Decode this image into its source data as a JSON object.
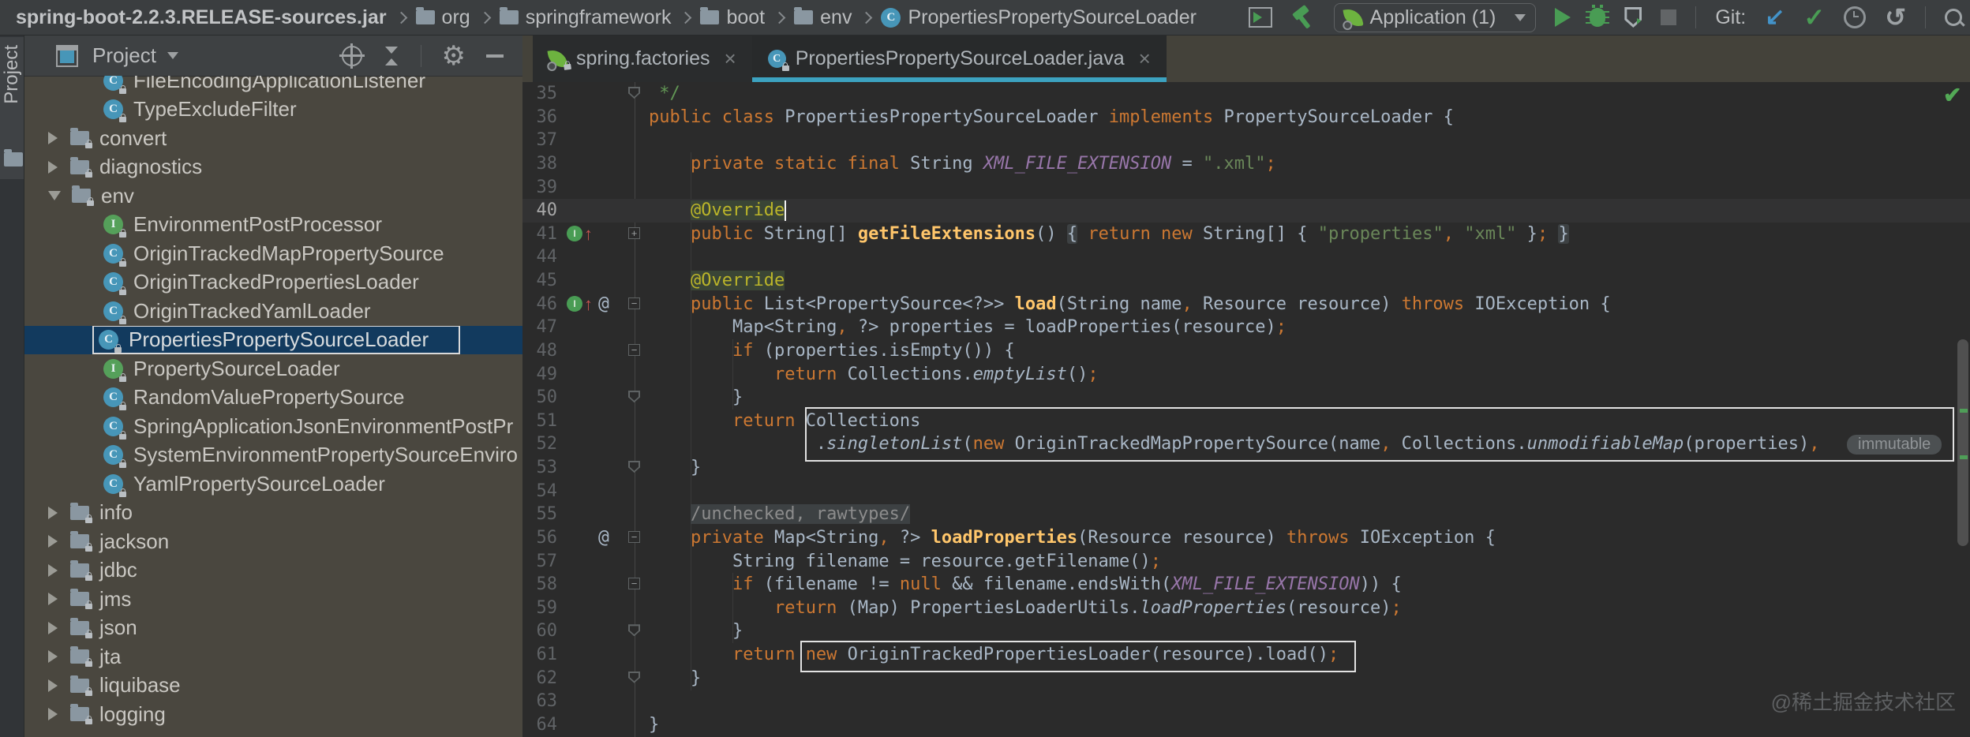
{
  "breadcrumbs": [
    {
      "label": "spring-boot-2.2.3.RELEASE-sources.jar",
      "icon": "none"
    },
    {
      "label": "org",
      "icon": "folder"
    },
    {
      "label": "springframework",
      "icon": "folder"
    },
    {
      "label": "boot",
      "icon": "folder"
    },
    {
      "label": "env",
      "icon": "folder"
    },
    {
      "label": "PropertiesPropertySourceLoader",
      "icon": "class"
    }
  ],
  "toolbar": {
    "run_config_label": "Application (1)",
    "git_label": "Git:"
  },
  "stripe": {
    "project_button": "Project"
  },
  "project_panel": {
    "title": "Project",
    "tree": [
      {
        "label": "FileEncodingApplicationListener",
        "icon": "class",
        "depth": 2
      },
      {
        "label": "TypeExcludeFilter",
        "icon": "class",
        "depth": 2
      },
      {
        "label": "convert",
        "icon": "folder",
        "depth": 1,
        "arrow": "right"
      },
      {
        "label": "diagnostics",
        "icon": "folder",
        "depth": 1,
        "arrow": "right"
      },
      {
        "label": "env",
        "icon": "folder",
        "depth": 1,
        "arrow": "down"
      },
      {
        "label": "EnvironmentPostProcessor",
        "icon": "interface",
        "depth": 2
      },
      {
        "label": "OriginTrackedMapPropertySource",
        "icon": "class",
        "depth": 2
      },
      {
        "label": "OriginTrackedPropertiesLoader",
        "icon": "class",
        "depth": 2
      },
      {
        "label": "OriginTrackedYamlLoader",
        "icon": "class",
        "depth": 2
      },
      {
        "label": "PropertiesPropertySourceLoader",
        "icon": "class",
        "depth": 2,
        "selected": true
      },
      {
        "label": "PropertySourceLoader",
        "icon": "interface",
        "depth": 2
      },
      {
        "label": "RandomValuePropertySource",
        "icon": "class",
        "depth": 2
      },
      {
        "label": "SpringApplicationJsonEnvironmentPostPr",
        "icon": "class",
        "depth": 2
      },
      {
        "label": "SystemEnvironmentPropertySourceEnviro",
        "icon": "class",
        "depth": 2
      },
      {
        "label": "YamlPropertySourceLoader",
        "icon": "class",
        "depth": 2
      },
      {
        "label": "info",
        "icon": "folder",
        "depth": 1,
        "arrow": "right"
      },
      {
        "label": "jackson",
        "icon": "folder",
        "depth": 1,
        "arrow": "right"
      },
      {
        "label": "jdbc",
        "icon": "folder",
        "depth": 1,
        "arrow": "right"
      },
      {
        "label": "jms",
        "icon": "folder",
        "depth": 1,
        "arrow": "right"
      },
      {
        "label": "json",
        "icon": "folder",
        "depth": 1,
        "arrow": "right"
      },
      {
        "label": "jta",
        "icon": "folder",
        "depth": 1,
        "arrow": "right"
      },
      {
        "label": "liquibase",
        "icon": "folder",
        "depth": 1,
        "arrow": "right"
      },
      {
        "label": "logging",
        "icon": "folder",
        "depth": 1,
        "arrow": "right"
      }
    ]
  },
  "tabs": [
    {
      "label": "spring.factories",
      "icon": "spring",
      "active": false
    },
    {
      "label": "PropertiesPropertySourceLoader.java",
      "icon": "class",
      "active": true
    }
  ],
  "editor": {
    "parameter_hint": "immutable",
    "lines": [
      {
        "n": "35",
        "fold": "end",
        "segs": [
          [
            "cm",
            " */"
          ]
        ]
      },
      {
        "n": "36",
        "segs": [
          [
            "kw",
            "public class "
          ],
          [
            "def",
            "PropertiesPropertySourceLoader "
          ],
          [
            "kw",
            "implements "
          ],
          [
            "def",
            "PropertySourceLoader {"
          ]
        ]
      },
      {
        "n": "37",
        "segs": []
      },
      {
        "n": "38",
        "segs": [
          [
            "def",
            "    "
          ],
          [
            "kw",
            "private static final "
          ],
          [
            "def",
            "String "
          ],
          [
            "const",
            "XML_FILE_EXTENSION "
          ],
          [
            "def",
            "= "
          ],
          [
            "str",
            "\".xml\""
          ],
          [
            "p",
            ";"
          ]
        ]
      },
      {
        "n": "39",
        "segs": []
      },
      {
        "n": "40",
        "current": true,
        "cursor": true,
        "segs": [
          [
            "def",
            "    "
          ],
          [
            "ann",
            "@Override"
          ]
        ]
      },
      {
        "n": "41",
        "fold": "plus",
        "over": true,
        "segs": [
          [
            "def",
            "    "
          ],
          [
            "kw",
            "public "
          ],
          [
            "def",
            "String[] "
          ],
          [
            "md",
            "getFileExtensions"
          ],
          [
            "def",
            "() "
          ],
          [
            "fold",
            "{"
          ],
          [
            "def",
            " "
          ],
          [
            "kw",
            "return new "
          ],
          [
            "def",
            "String[] { "
          ],
          [
            "str",
            "\"properties\""
          ],
          [
            "p",
            ","
          ],
          [
            "def",
            " "
          ],
          [
            "str",
            "\"xml\""
          ],
          [
            "def",
            " }"
          ],
          [
            "p",
            ";"
          ],
          [
            "def",
            " "
          ],
          [
            "fold",
            "}"
          ]
        ]
      },
      {
        "n": "44",
        "segs": []
      },
      {
        "n": "45",
        "segs": [
          [
            "def",
            "    "
          ],
          [
            "ann",
            "@Override"
          ]
        ]
      },
      {
        "n": "46",
        "fold": "minus",
        "over": true,
        "at": true,
        "segs": [
          [
            "def",
            "    "
          ],
          [
            "kw",
            "public "
          ],
          [
            "def",
            "List<PropertySource<?>> "
          ],
          [
            "md",
            "load"
          ],
          [
            "def",
            "(String name"
          ],
          [
            "p",
            ","
          ],
          [
            "def",
            " Resource resource) "
          ],
          [
            "kw",
            "throws "
          ],
          [
            "def",
            "IOException {"
          ]
        ]
      },
      {
        "n": "47",
        "segs": [
          [
            "def",
            "        Map<String"
          ],
          [
            "p",
            ","
          ],
          [
            "def",
            " ?> properties = loadProperties(resource)"
          ],
          [
            "p",
            ";"
          ]
        ]
      },
      {
        "n": "48",
        "fold": "minus",
        "segs": [
          [
            "def",
            "        "
          ],
          [
            "kw",
            "if "
          ],
          [
            "def",
            "(properties.isEmpty()) {"
          ]
        ]
      },
      {
        "n": "49",
        "segs": [
          [
            "def",
            "            "
          ],
          [
            "kw",
            "return "
          ],
          [
            "def",
            "Collections."
          ],
          [
            "it",
            "emptyList"
          ],
          [
            "def",
            "()"
          ],
          [
            "p",
            ";"
          ]
        ]
      },
      {
        "n": "50",
        "fold": "end",
        "segs": [
          [
            "def",
            "        }"
          ]
        ]
      },
      {
        "n": "51",
        "segs": [
          [
            "def",
            "        "
          ],
          [
            "kw",
            "return "
          ],
          [
            "def",
            "Collections"
          ]
        ]
      },
      {
        "n": "52",
        "hint": true,
        "segs": [
          [
            "def",
            "                ."
          ],
          [
            "it",
            "singletonList"
          ],
          [
            "def",
            "("
          ],
          [
            "kw",
            "new "
          ],
          [
            "def",
            "OriginTrackedMapPropertySource(name"
          ],
          [
            "p",
            ","
          ],
          [
            "def",
            " Collections."
          ],
          [
            "it",
            "unmodifiableMap"
          ],
          [
            "def",
            "(properties)"
          ],
          [
            "p",
            ","
          ]
        ]
      },
      {
        "n": "53",
        "fold": "end",
        "segs": [
          [
            "def",
            "    }"
          ]
        ]
      },
      {
        "n": "54",
        "segs": []
      },
      {
        "n": "55",
        "segs": [
          [
            "def",
            "    "
          ],
          [
            "foldtxt",
            "/unchecked, rawtypes/"
          ]
        ]
      },
      {
        "n": "56",
        "fold": "minus",
        "at": true,
        "segs": [
          [
            "def",
            "    "
          ],
          [
            "kw",
            "private "
          ],
          [
            "def",
            "Map<String"
          ],
          [
            "p",
            ","
          ],
          [
            "def",
            " ?> "
          ],
          [
            "md",
            "loadProperties"
          ],
          [
            "def",
            "(Resource resource) "
          ],
          [
            "kw",
            "throws "
          ],
          [
            "def",
            "IOException {"
          ]
        ]
      },
      {
        "n": "57",
        "segs": [
          [
            "def",
            "        String filename = resource.getFilename()"
          ],
          [
            "p",
            ";"
          ]
        ]
      },
      {
        "n": "58",
        "fold": "minus",
        "segs": [
          [
            "def",
            "        "
          ],
          [
            "kw",
            "if "
          ],
          [
            "def",
            "(filename != "
          ],
          [
            "kw",
            "null "
          ],
          [
            "def",
            "&& filename.endsWith("
          ],
          [
            "const",
            "XML_FILE_EXTENSION"
          ],
          [
            "def",
            ")) {"
          ]
        ]
      },
      {
        "n": "59",
        "segs": [
          [
            "def",
            "            "
          ],
          [
            "kw",
            "return "
          ],
          [
            "def",
            "(Map) PropertiesLoaderUtils."
          ],
          [
            "it",
            "loadProperties"
          ],
          [
            "def",
            "(resource)"
          ],
          [
            "p",
            ";"
          ]
        ]
      },
      {
        "n": "60",
        "fold": "end",
        "segs": [
          [
            "def",
            "        }"
          ]
        ]
      },
      {
        "n": "61",
        "segs": [
          [
            "def",
            "        "
          ],
          [
            "kw",
            "return "
          ],
          [
            "kw",
            "new "
          ],
          [
            "def",
            "OriginTrackedPropertiesLoader(resource).load()"
          ],
          [
            "p",
            ";"
          ]
        ]
      },
      {
        "n": "62",
        "fold": "end",
        "segs": [
          [
            "def",
            "    }"
          ]
        ]
      },
      {
        "n": "63",
        "segs": []
      },
      {
        "n": "64",
        "segs": [
          [
            "def",
            "}"
          ]
        ]
      }
    ]
  },
  "watermark": "@稀土掘金技术社区",
  "colors": {
    "editor_bg": "#2B2B2B",
    "tree_bg": "#4A473F",
    "chrome_bg": "#3B3E40",
    "selection_bg": "#123A5E",
    "tab_underline": "#3CA2C0",
    "keyword": "#CC7832",
    "string": "#6A8759",
    "constant": "#9876AA",
    "method_decl": "#FFC66B",
    "annotation": "#BBB529",
    "run_green": "#499C54",
    "git_blue": "#4393C9"
  }
}
